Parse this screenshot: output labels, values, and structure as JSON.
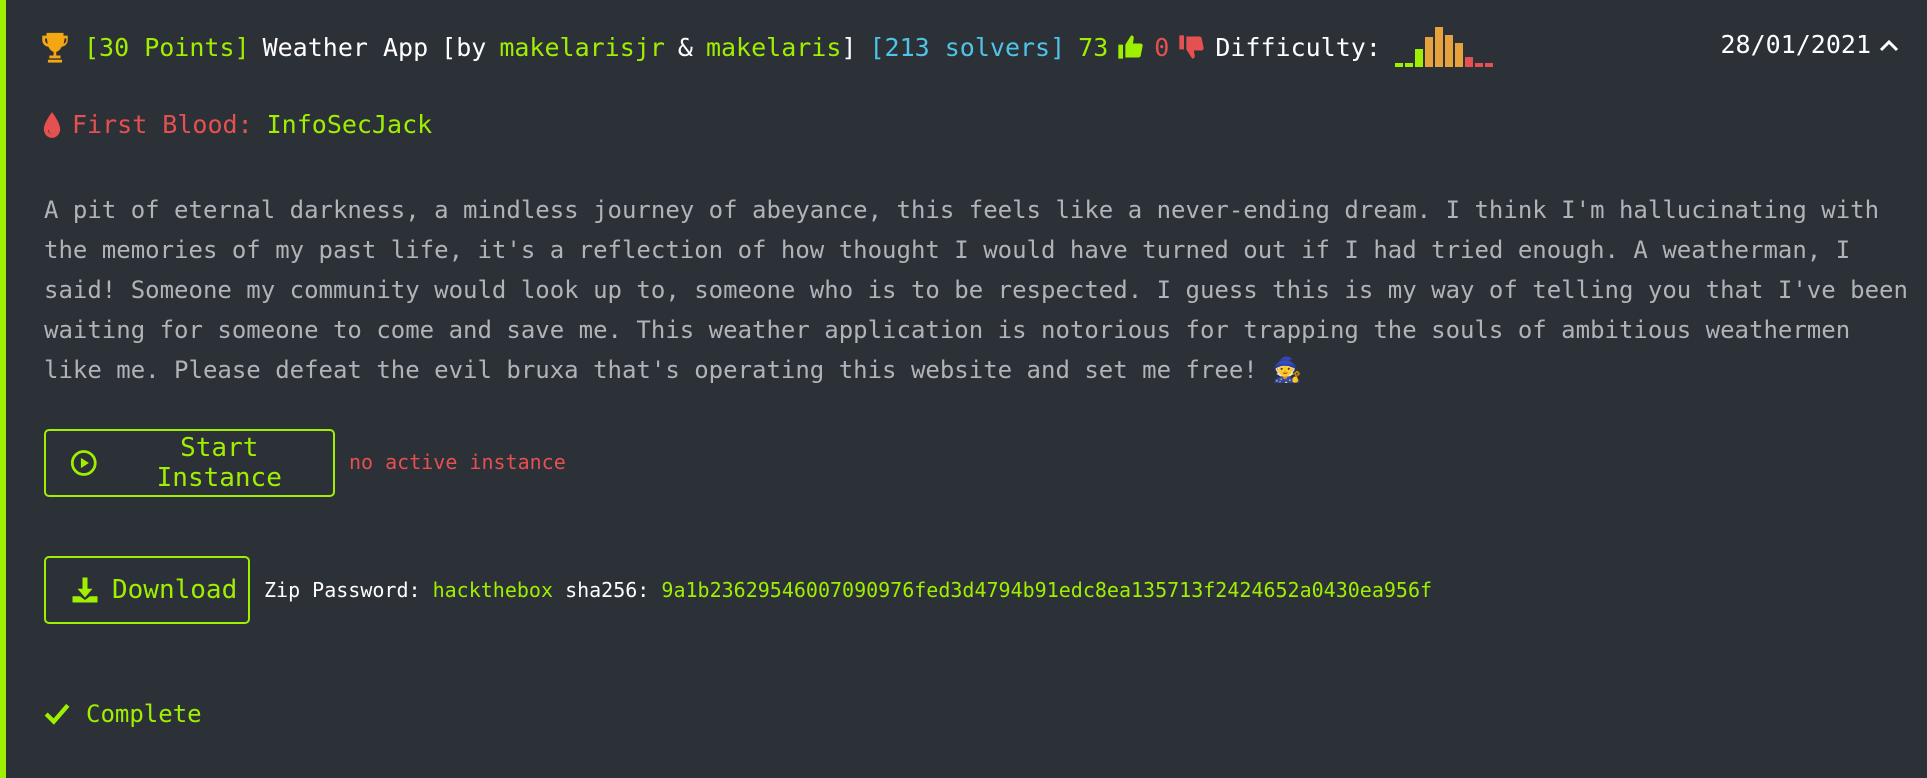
{
  "challenge": {
    "points": "[30 Points]",
    "name": "Weather App",
    "by_prefix": "[by",
    "author1": "makelarisjr",
    "amp": "&",
    "author2": "makelaris",
    "by_suffix": "]",
    "solvers": "[213 solvers]",
    "likes": "73",
    "dislikes": "0",
    "difficulty_label": "Difficulty:",
    "difficulty_bars": [
      {
        "level": 0.1,
        "color": "#9fef00"
      },
      {
        "level": 0.1,
        "color": "#9fef00"
      },
      {
        "level": 0.45,
        "color": "#9fef00"
      },
      {
        "level": 0.75,
        "color": "#e6a23c"
      },
      {
        "level": 1.0,
        "color": "#e6a23c"
      },
      {
        "level": 0.8,
        "color": "#e6a23c"
      },
      {
        "level": 0.6,
        "color": "#e6a23c"
      },
      {
        "level": 0.25,
        "color": "#e55050"
      },
      {
        "level": 0.1,
        "color": "#e55050"
      },
      {
        "level": 0.1,
        "color": "#e55050"
      }
    ],
    "date": "28/01/2021",
    "icons": {
      "trophy": "trophy-icon",
      "like": "thumbs-up-icon",
      "dislike": "thumbs-down-icon",
      "collapse": "chevron-up-icon"
    }
  },
  "first_blood": {
    "label": "First Blood:",
    "user": "InfoSecJack",
    "icon": "blood-drop-icon"
  },
  "description": "A pit of eternal darkness, a mindless journey of abeyance, this feels like a never-ending dream. I think I'm hallucinating with the memories of my past life, it's a reflection of how thought I would have turned out if I had tried enough. A weatherman, I said! Someone my community would look up to, someone who is to be respected. I guess this is my way of telling you that I've been waiting for someone to come and save me. This weather application is notorious for trapping the souls of ambitious weathermen like me. Please defeat the evil bruxa that's operating this website and set me free! 🧙",
  "instance": {
    "button_label": "Start Instance",
    "status": "no active instance",
    "icon": "play-circle-icon"
  },
  "download": {
    "button_label": "Download",
    "icon": "download-icon",
    "zip_label": "Zip Password:",
    "zip_password": "hackthebox",
    "sha_label": "sha256:",
    "sha256": "9a1b23629546007090976fed3d4794b91edc8ea135713f2424652a0430ea956f"
  },
  "status": {
    "label": "Complete",
    "icon": "check-icon"
  },
  "colors": {
    "accent": "#9fef00",
    "background": "#2c3037",
    "danger": "#e55050",
    "info": "#4fc4e8",
    "warning": "#e6a23c"
  }
}
